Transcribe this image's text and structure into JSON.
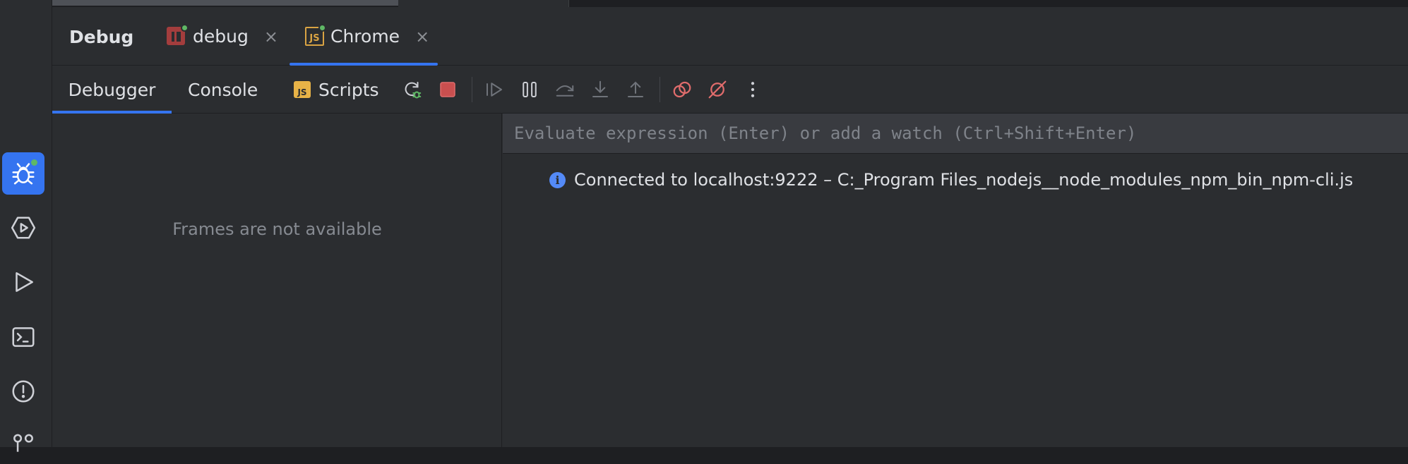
{
  "tool_window": {
    "title": "Debug",
    "session_tabs": [
      {
        "label": "debug",
        "icon": "nodejs-debug-icon",
        "close": "×"
      },
      {
        "label": "Chrome",
        "icon": "js-file-icon",
        "close": "×",
        "selected": true
      }
    ]
  },
  "sub_tabs": [
    {
      "label": "Debugger",
      "selected": true
    },
    {
      "label": "Console"
    },
    {
      "label": "Scripts",
      "icon": "js-badge-icon",
      "badge": "JS"
    }
  ],
  "toolbar_icons": [
    "rerun-debug-icon",
    "stop-icon",
    "resume-icon",
    "pause-icon",
    "step-over-icon",
    "step-into-icon",
    "step-out-icon",
    "view-breakpoints-icon",
    "mute-breakpoints-icon",
    "more-options-icon"
  ],
  "frames": {
    "empty_text": "Frames are not available"
  },
  "evaluate": {
    "placeholder": "Evaluate expression (Enter) or add a watch (Ctrl+Shift+Enter)",
    "value": ""
  },
  "console_message": {
    "icon": "info-icon",
    "text": "Connected to localhost:9222 – C:_Program Files_nodejs__node_modules_npm_bin_npm-cli.js"
  },
  "left_toolbar": [
    {
      "icon": "debug-bug-icon",
      "active": true
    },
    {
      "icon": "services-icon"
    },
    {
      "icon": "run-icon"
    },
    {
      "icon": "terminal-icon"
    },
    {
      "icon": "problems-icon"
    },
    {
      "icon": "git-icon"
    }
  ],
  "colors": {
    "accent": "#3574f0",
    "panel_bg": "#2b2d30",
    "stop_red": "#db5c5c",
    "js_yellow": "#e8b347",
    "status_green": "#5fb865"
  }
}
